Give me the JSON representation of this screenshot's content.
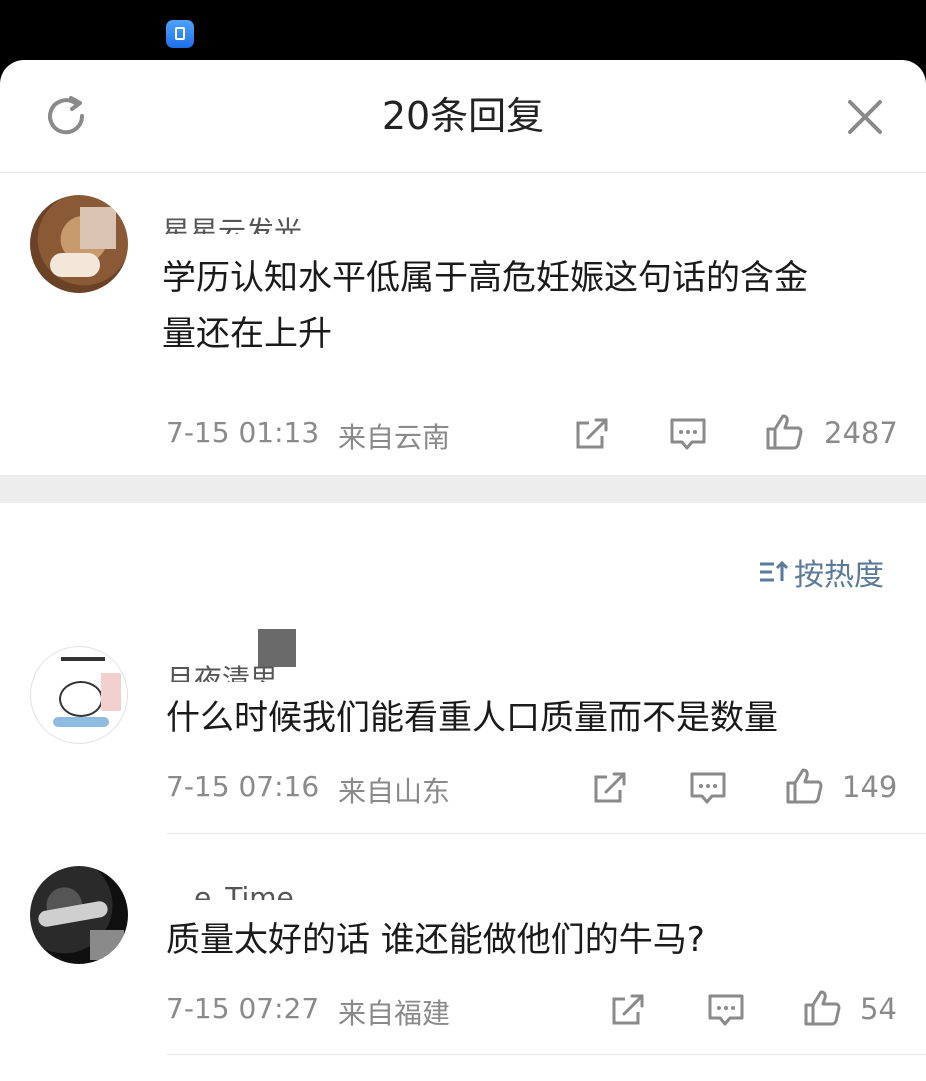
{
  "header": {
    "title": "20条回复"
  },
  "op": {
    "username": "星星云发光",
    "text_line1": "学历认知水平低属于高危妊娠这句话的含金",
    "text_line2": "量还在上升",
    "time": "7-15 01:13",
    "location": "来自云南",
    "likes": "2487"
  },
  "sort": {
    "label": "按热度"
  },
  "replies": [
    {
      "username": "月夜清思",
      "text": "什么时候我们能看重人口质量而不是数量",
      "time": "7-15 07:16",
      "location": "来自山东",
      "likes": "149"
    },
    {
      "username": "__e_Time__",
      "text": "质量太好的话 谁还能做他们的牛马?",
      "time": "7-15 07:27",
      "location": "来自福建",
      "likes": "54"
    }
  ],
  "colors": {
    "background": "#ffffff",
    "divider_band": "#ededed",
    "meta": "#8a8a8a",
    "sort_link": "#5b7a99"
  }
}
